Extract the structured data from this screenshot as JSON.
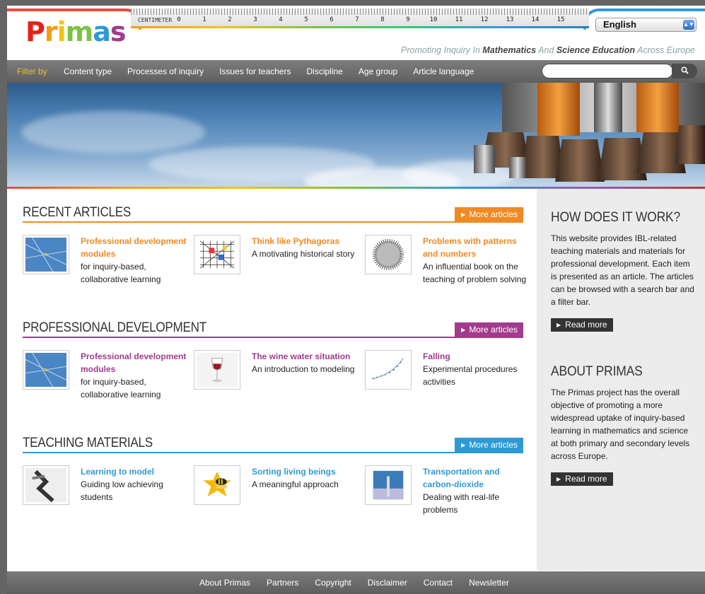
{
  "header": {
    "logo": "Primas",
    "ruler_units": "CENTIMETER",
    "ruler_numbers": [
      "0",
      "1",
      "2",
      "3",
      "4",
      "5",
      "6",
      "7",
      "8",
      "9",
      "10",
      "11",
      "12",
      "13",
      "14",
      "15"
    ],
    "language": "English",
    "tagline_1": "Promoting Inquiry In ",
    "tagline_2": "Mathematics",
    "tagline_3": " And ",
    "tagline_4": "Science Education",
    "tagline_5": " Across Europe"
  },
  "nav": {
    "filter_label": "Filter by",
    "items": [
      "Content type",
      "Processes of inquiry",
      "Issues for teachers",
      "Discipline",
      "Age group",
      "Article language"
    ],
    "search_placeholder": "",
    "search_icon": "search-icon"
  },
  "sections": [
    {
      "title": "RECENT ARTICLES",
      "color": "#f08a24",
      "more_label": "More articles",
      "articles": [
        {
          "title": "Professional development modules",
          "desc": "for inquiry-based, collaborative learning"
        },
        {
          "title": "Think like Pythagoras",
          "desc": "A motivating historical story"
        },
        {
          "title": "Problems with patterns and numbers",
          "desc": "An influential book on the teaching of problem solving"
        }
      ]
    },
    {
      "title": "PROFESSIONAL DEVELOPMENT",
      "color": "#a23b8c",
      "more_label": "More articles",
      "articles": [
        {
          "title": "Professional development modules",
          "desc": "for inquiry-based, collaborative learning"
        },
        {
          "title": "The wine water situation",
          "desc": "An introduction to modeling"
        },
        {
          "title": "Falling",
          "desc": "Experimental procedures activities"
        }
      ]
    },
    {
      "title": "TEACHING MATERIALS",
      "color": "#2d9ad6",
      "more_label": "More articles",
      "articles": [
        {
          "title": "Learning to model",
          "desc": "Guiding low achieving students"
        },
        {
          "title": "Sorting living beings",
          "desc": "A meaningful approach"
        },
        {
          "title": "Transportation and carbon-dioxide",
          "desc": "Dealing with real-life problems"
        }
      ]
    }
  ],
  "sidebar": {
    "how_title": "HOW DOES IT WORK?",
    "how_text": "This website provides IBL-related teaching materials and materials for professional development. Each item is presented as an article. The articles can be browsed with a search bar and a filter bar.",
    "how_button": "Read more",
    "about_title": "ABOUT PRIMAS",
    "about_text": "The Primas project has the overall objective of promoting a more widespread uptake of inquiry-based learning in mathematics and science at both primary and secondary levels across Europe.",
    "about_button": "Read more"
  },
  "footer": {
    "links": [
      "About Primas",
      "Partners",
      "Copyright",
      "Disclaimer",
      "Contact",
      "Newsletter"
    ]
  }
}
